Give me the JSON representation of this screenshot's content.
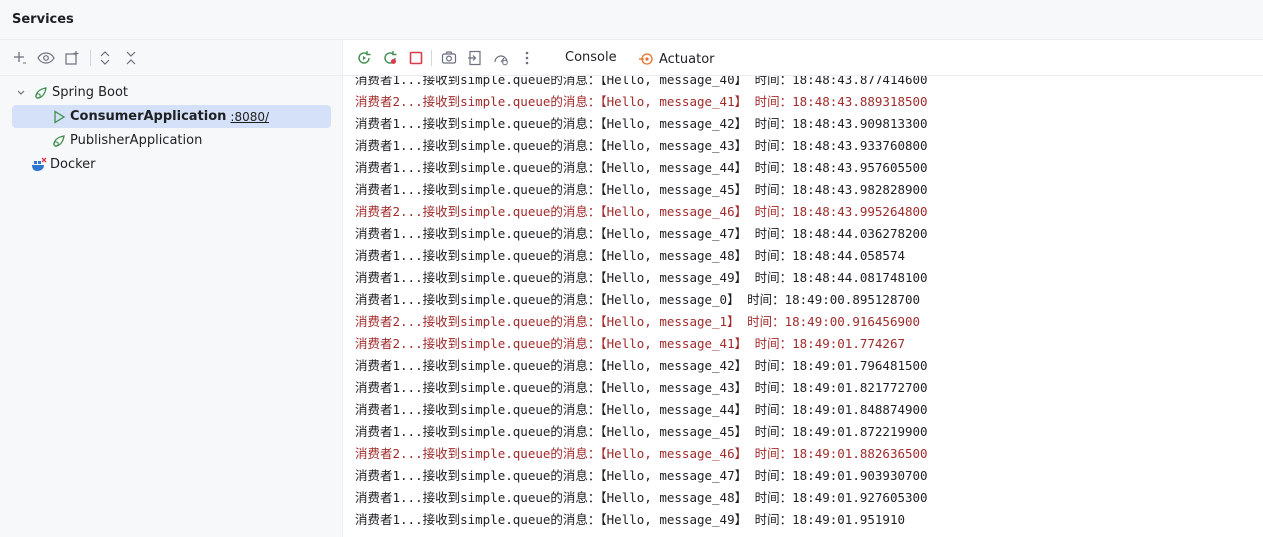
{
  "panel": {
    "title": "Services"
  },
  "tree": {
    "spring_boot": "Spring Boot",
    "consumer": "ConsumerApplication",
    "consumer_port": ":8080/",
    "publisher": "PublisherApplication",
    "docker": "Docker"
  },
  "tabs": {
    "console": "Console",
    "actuator": "Actuator"
  },
  "colors": {
    "normal_text": "#1e1f22",
    "stderr_text": "#a12b2b",
    "selection": "#d5e1f9",
    "run_green": "#3f8f4f",
    "stop_red": "#db3b4b",
    "docker_blue": "#2f74d0",
    "actuator_orange": "#e8702a"
  },
  "console_lines": [
    {
      "text": "消费者1...接收到simple.queue的消息：【Hello, message_40】 时间：18:48:43.877414600",
      "stream": "out"
    },
    {
      "text": "消费者2...接收到simple.queue的消息：【Hello, message_41】 时间：18:48:43.889318500",
      "stream": "err"
    },
    {
      "text": "消费者1...接收到simple.queue的消息：【Hello, message_42】 时间：18:48:43.909813300",
      "stream": "out"
    },
    {
      "text": "消费者1...接收到simple.queue的消息：【Hello, message_43】 时间：18:48:43.933760800",
      "stream": "out"
    },
    {
      "text": "消费者1...接收到simple.queue的消息：【Hello, message_44】 时间：18:48:43.957605500",
      "stream": "out"
    },
    {
      "text": "消费者1...接收到simple.queue的消息：【Hello, message_45】 时间：18:48:43.982828900",
      "stream": "out"
    },
    {
      "text": "消费者2...接收到simple.queue的消息：【Hello, message_46】 时间：18:48:43.995264800",
      "stream": "err"
    },
    {
      "text": "消费者1...接收到simple.queue的消息：【Hello, message_47】 时间：18:48:44.036278200",
      "stream": "out"
    },
    {
      "text": "消费者1...接收到simple.queue的消息：【Hello, message_48】 时间：18:48:44.058574",
      "stream": "out"
    },
    {
      "text": "消费者1...接收到simple.queue的消息：【Hello, message_49】 时间：18:48:44.081748100",
      "stream": "out"
    },
    {
      "text": "消费者1...接收到simple.queue的消息：【Hello, message_0】 时间：18:49:00.895128700",
      "stream": "out"
    },
    {
      "text": "消费者2...接收到simple.queue的消息：【Hello, message_1】 时间：18:49:00.916456900",
      "stream": "err"
    },
    {
      "text": "消费者2...接收到simple.queue的消息：【Hello, message_41】 时间：18:49:01.774267",
      "stream": "err"
    },
    {
      "text": "消费者1...接收到simple.queue的消息：【Hello, message_42】 时间：18:49:01.796481500",
      "stream": "out"
    },
    {
      "text": "消费者1...接收到simple.queue的消息：【Hello, message_43】 时间：18:49:01.821772700",
      "stream": "out"
    },
    {
      "text": "消费者1...接收到simple.queue的消息：【Hello, message_44】 时间：18:49:01.848874900",
      "stream": "out"
    },
    {
      "text": "消费者1...接收到simple.queue的消息：【Hello, message_45】 时间：18:49:01.872219900",
      "stream": "out"
    },
    {
      "text": "消费者2...接收到simple.queue的消息：【Hello, message_46】 时间：18:49:01.882636500",
      "stream": "err"
    },
    {
      "text": "消费者1...接收到simple.queue的消息：【Hello, message_47】 时间：18:49:01.903930700",
      "stream": "out"
    },
    {
      "text": "消费者1...接收到simple.queue的消息：【Hello, message_48】 时间：18:49:01.927605300",
      "stream": "out"
    },
    {
      "text": "消费者1...接收到simple.queue的消息：【Hello, message_49】 时间：18:49:01.951910",
      "stream": "out"
    }
  ]
}
